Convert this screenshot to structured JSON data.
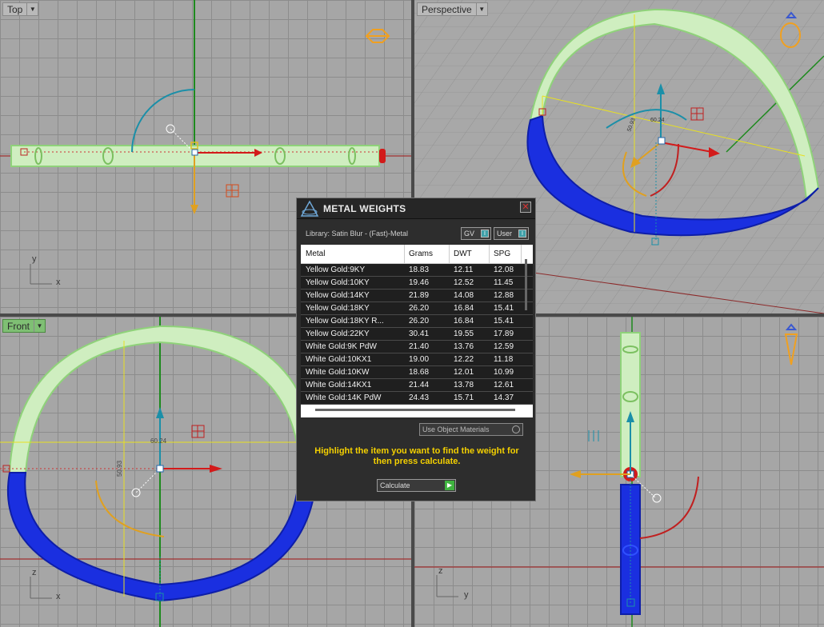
{
  "viewports": {
    "top": {
      "label": "Top",
      "axis_y": "y",
      "axis_x": "x"
    },
    "perspective": {
      "label": "Perspective"
    },
    "front": {
      "label": "Front",
      "axis_z": "z",
      "axis_x": "x",
      "dim_width": "60.24",
      "dim_height": "50.93"
    },
    "right": {
      "axis_z": "z",
      "axis_y": "y"
    },
    "persp_dim_width": "60.24",
    "persp_dim_height": "50.93"
  },
  "panel": {
    "title": "METAL WEIGHTS",
    "library": "Library: Satin Blur - (Fast)-Metal",
    "toggle_gv": "GV",
    "toggle_user": "User",
    "columns": [
      "Metal",
      "Grams",
      "DWT",
      "SPG"
    ],
    "rows": [
      [
        "Yellow Gold:9KY",
        "18.83",
        "12.11",
        "12.08"
      ],
      [
        "Yellow Gold:10KY",
        "19.46",
        "12.52",
        "11.45"
      ],
      [
        "Yellow Gold:14KY",
        "21.89",
        "14.08",
        "12.88"
      ],
      [
        "Yellow Gold:18KY",
        "26.20",
        "16.84",
        "15.41"
      ],
      [
        "Yellow Gold:18KY R...",
        "26.20",
        "16.84",
        "15.41"
      ],
      [
        "Yellow Gold:22KY",
        "30.41",
        "19.55",
        "17.89"
      ],
      [
        "White Gold:9K PdW",
        "21.40",
        "13.76",
        "12.59"
      ],
      [
        "White Gold:10KX1",
        "19.00",
        "12.22",
        "11.18"
      ],
      [
        "White Gold:10KW",
        "18.68",
        "12.01",
        "10.99"
      ],
      [
        "White Gold:14KX1",
        "21.44",
        "13.78",
        "12.61"
      ],
      [
        "White Gold:14K PdW",
        "24.43",
        "15.71",
        "14.37"
      ]
    ],
    "use_object_materials": "Use Object Materials",
    "hint": "Highlight the item you want to find the weight for then press calculate.",
    "calculate": "Calculate"
  },
  "colors": {
    "accent_teal": "#3fa0a9",
    "hint_yellow": "#f4d000",
    "ring_green": "#cfeec0",
    "ring_blue": "#1a2fe0"
  }
}
